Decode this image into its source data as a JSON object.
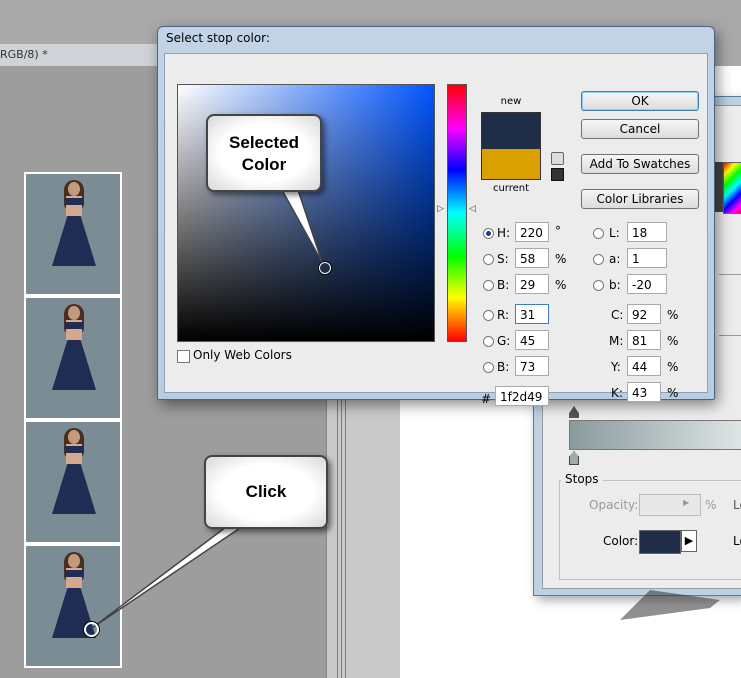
{
  "document": {
    "tab_text": "RGB/8) *"
  },
  "dialog": {
    "title": "Select stop color:",
    "new_label": "new",
    "current_label": "current",
    "new_color": "#1f2d49",
    "current_color": "#daa000",
    "buttons": {
      "ok": "OK",
      "cancel": "Cancel",
      "add_to_swatches": "Add To Swatches",
      "color_libraries": "Color Libraries"
    },
    "only_web_colors": "Only Web Colors",
    "fields": {
      "h": {
        "label": "H:",
        "value": "220",
        "unit": "°"
      },
      "s": {
        "label": "S:",
        "value": "58",
        "unit": "%"
      },
      "b": {
        "label": "B:",
        "value": "29",
        "unit": "%"
      },
      "r": {
        "label": "R:",
        "value": "31"
      },
      "g": {
        "label": "G:",
        "value": "45"
      },
      "bb": {
        "label": "B:",
        "value": "73"
      },
      "l": {
        "label": "L:",
        "value": "18"
      },
      "a": {
        "label": "a:",
        "value": "1"
      },
      "lab_b": {
        "label": "b:",
        "value": "-20"
      },
      "c": {
        "label": "C:",
        "value": "92",
        "unit": "%"
      },
      "m": {
        "label": "M:",
        "value": "81",
        "unit": "%"
      },
      "y": {
        "label": "Y:",
        "value": "44",
        "unit": "%"
      },
      "k": {
        "label": "K:",
        "value": "43",
        "unit": "%"
      },
      "hex": {
        "label": "#",
        "value": "1f2d49"
      }
    }
  },
  "gradient_editor": {
    "stops_legend": "Stops",
    "opacity_label": "Opacity:",
    "opacity_unit": "%",
    "color_label": "Color:",
    "cut_label_1": "Lo",
    "cut_label_2": "Lo"
  },
  "callouts": {
    "selected_color": "Selected\nColor",
    "click": "Click"
  }
}
